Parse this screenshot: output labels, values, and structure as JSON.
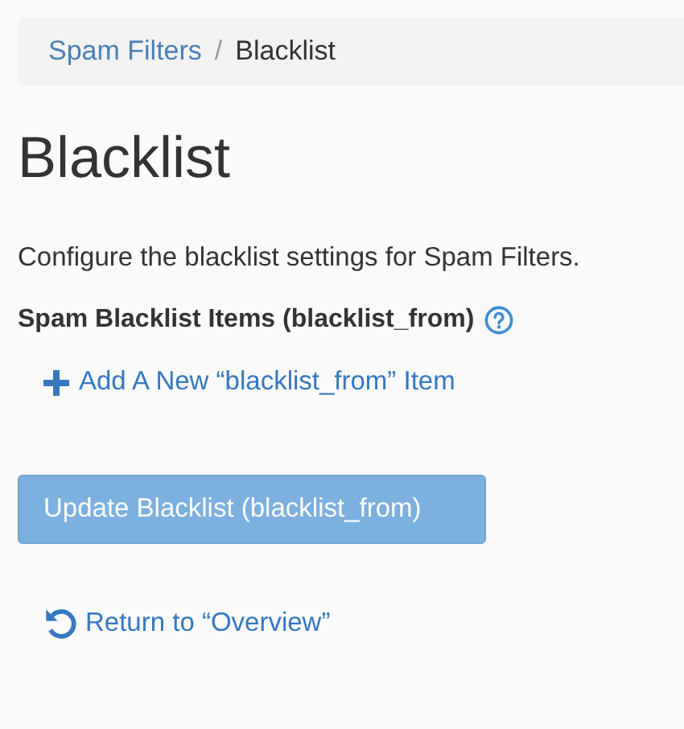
{
  "breadcrumb": [
    {
      "label": "Spam Filters",
      "kind": "link"
    },
    {
      "label": "Blacklist",
      "kind": "current"
    }
  ],
  "breadcrumb_separator": "/",
  "title": "Blacklist",
  "description": "Configure the blacklist settings for Spam Filters.",
  "field_label": "Spam Blacklist Items (blacklist_from)",
  "add_link": "Add A New “blacklist_from” Item",
  "submit_button": {
    "label": "Update Blacklist (blacklist_from)",
    "disabled": true
  },
  "return_link": "Return to “Overview”"
}
